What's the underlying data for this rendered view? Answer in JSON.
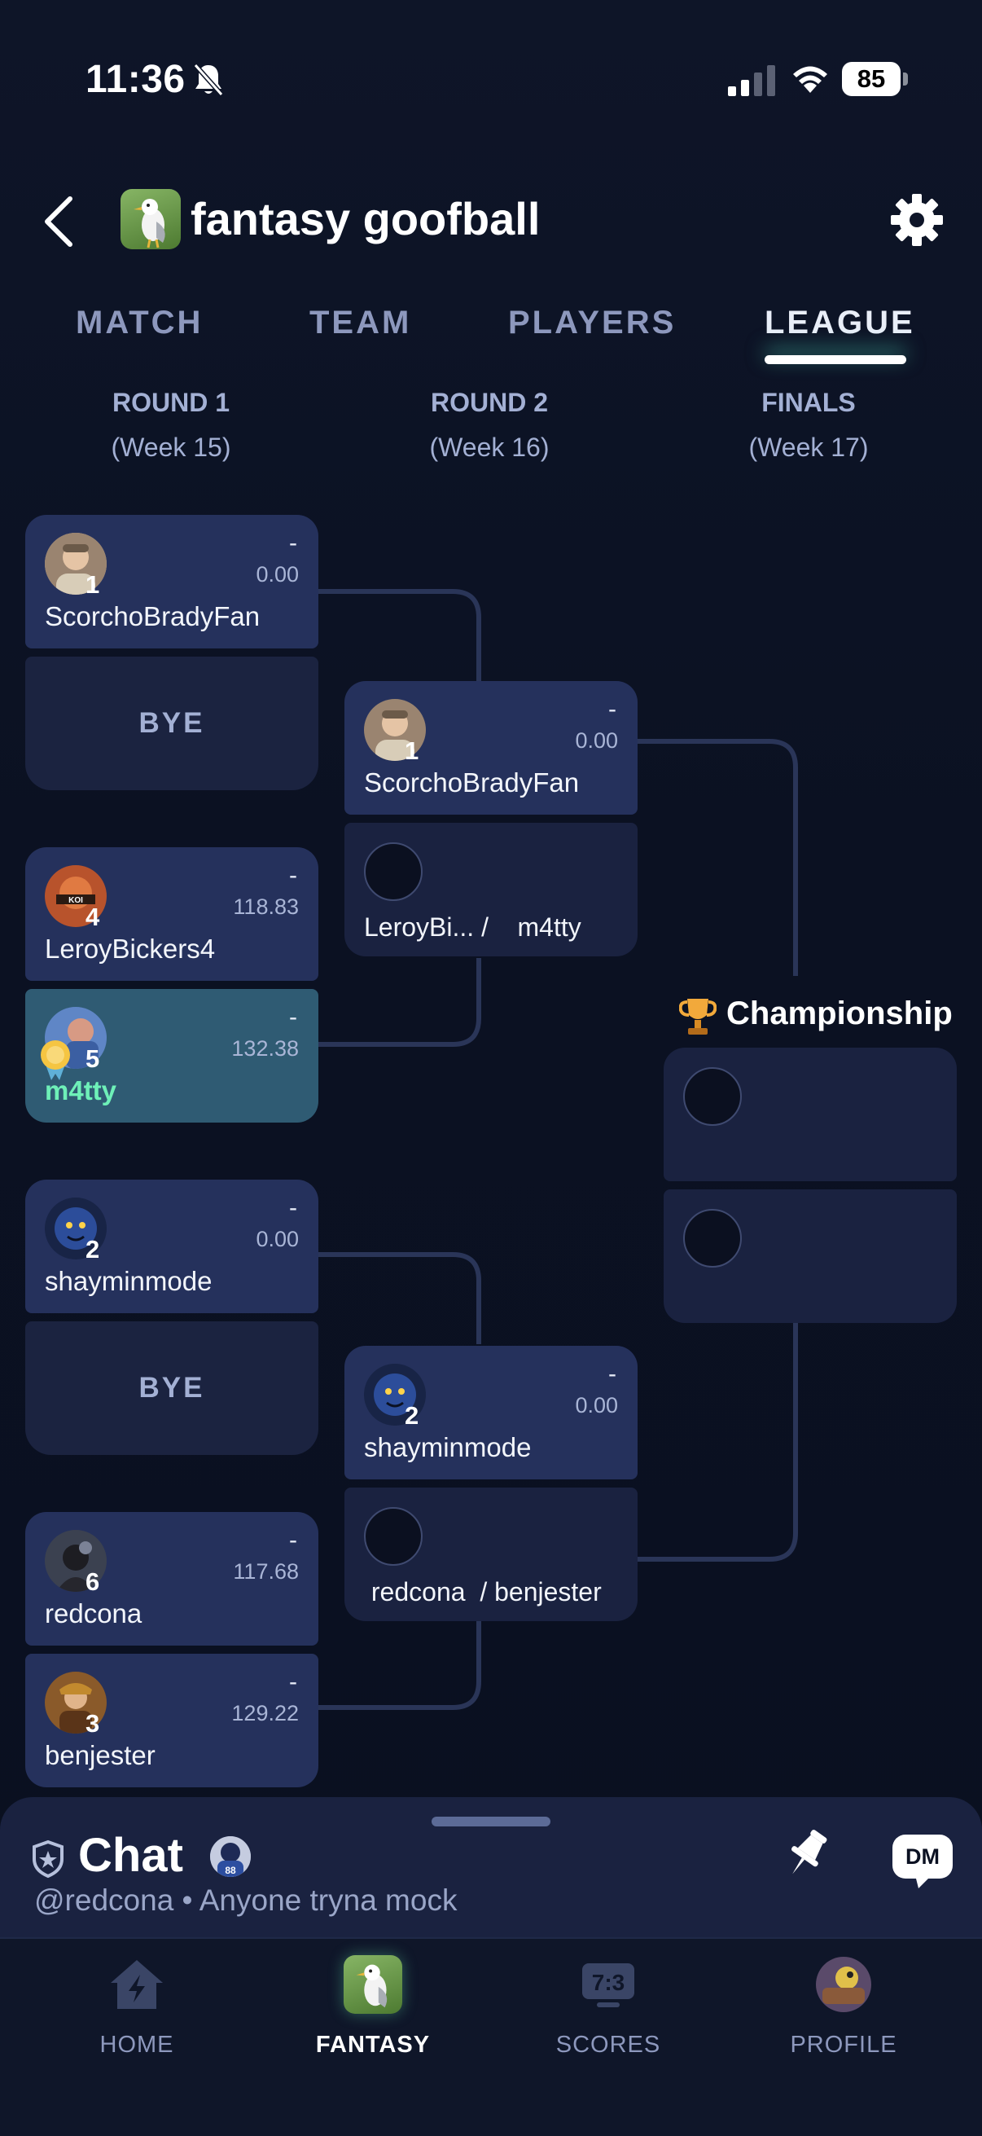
{
  "status_bar": {
    "time": "11:36",
    "battery": "85"
  },
  "header": {
    "title": "fantasy goofball"
  },
  "tabs": [
    {
      "label": "MATCH"
    },
    {
      "label": "TEAM"
    },
    {
      "label": "PLAYERS"
    },
    {
      "label": "LEAGUE",
      "active": true
    }
  ],
  "rounds": [
    {
      "name": "ROUND 1",
      "week": "(Week 15)"
    },
    {
      "name": "ROUND 2",
      "week": "(Week 16)"
    },
    {
      "name": "FINALS",
      "week": "(Week 17)"
    }
  ],
  "bracket": {
    "r1": [
      {
        "seed": "1",
        "name": "ScorchoBradyFan",
        "dash": "-",
        "score": "0.00"
      },
      {
        "bye": "BYE"
      },
      {
        "seed": "4",
        "name": "LeroyBickers4",
        "dash": "-",
        "score": "118.83"
      },
      {
        "seed": "5",
        "name": "m4tty",
        "dash": "-",
        "score": "132.38"
      },
      {
        "seed": "2",
        "name": "shayminmode",
        "dash": "-",
        "score": "0.00"
      },
      {
        "bye": "BYE"
      },
      {
        "seed": "6",
        "name": "redcona",
        "dash": "-",
        "score": "117.68"
      },
      {
        "seed": "3",
        "name": "benjester",
        "dash": "-",
        "score": "129.22"
      }
    ],
    "r2": [
      {
        "seed": "1",
        "name": "ScorchoBradyFan",
        "dash": "-",
        "score": "0.00"
      },
      {
        "pending": "LeroyBi... /    m4tty"
      },
      {
        "seed": "2",
        "name": "shayminmode",
        "dash": "-",
        "score": "0.00"
      },
      {
        "pending": " redcona  / benjester"
      }
    ],
    "championship": {
      "label": "Championship"
    }
  },
  "chat": {
    "title": "Chat",
    "preview": "@redcona • Anyone tryna mock",
    "dm_label": "DM"
  },
  "nav": [
    {
      "label": "HOME",
      "icon": "home-bolt-icon"
    },
    {
      "label": "FANTASY",
      "icon": "fantasy-league-icon",
      "active": true
    },
    {
      "label": "SCORES",
      "icon": "scores-icon"
    },
    {
      "label": "PROFILE",
      "icon": "profile-avatar-icon"
    }
  ],
  "colors": {
    "background": "#0b1122",
    "card": "#24305a",
    "card_empty": "#1a2240",
    "highlight": "#2f5b73",
    "user_name": "#6ef0b8",
    "accent_glow": "#50dcbe"
  }
}
